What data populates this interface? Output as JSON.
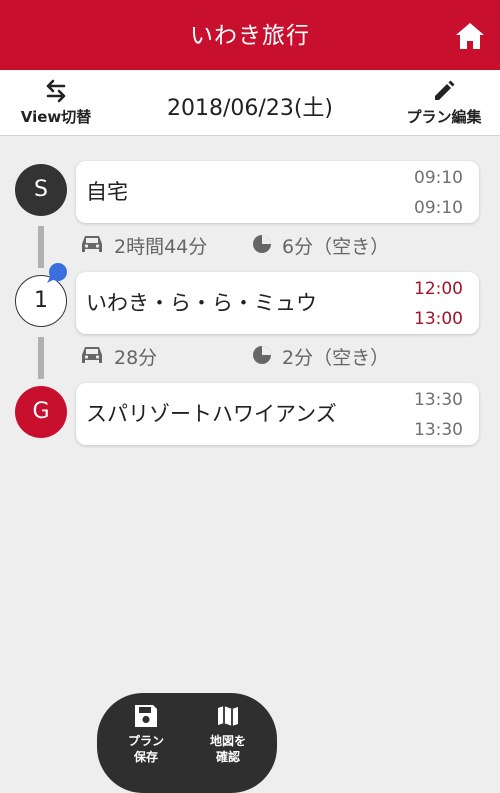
{
  "header": {
    "title": "いわき旅行",
    "home_icon": "home-icon"
  },
  "toolbar": {
    "view_toggle_label": "View切替",
    "date": "2018/06/23(土)",
    "edit_label": "プラン編集"
  },
  "stops": [
    {
      "marker": "S",
      "name": "自宅",
      "arrival": "09:10",
      "departure": "09:10",
      "time_highlight": false
    },
    {
      "marker": "1",
      "name": "いわき・ら・ら・ミュウ",
      "arrival": "12:00",
      "departure": "13:00",
      "time_highlight": true
    },
    {
      "marker": "G",
      "name": "スパリゾートハワイアンズ",
      "arrival": "13:30",
      "departure": "13:30",
      "time_highlight": false
    }
  ],
  "legs": [
    {
      "duration": "2時間44分",
      "idle": "6分（空き）"
    },
    {
      "duration": "28分",
      "idle": "2分（空き）"
    }
  ],
  "actions": {
    "save_line1": "プラン",
    "save_line2": "保存",
    "map_line1": "地図を",
    "map_line2": "確認"
  },
  "colors": {
    "brand_red": "#c8102e",
    "time_red": "#a0142c",
    "dark": "#333333",
    "badge_blue": "#3a6fe0"
  }
}
